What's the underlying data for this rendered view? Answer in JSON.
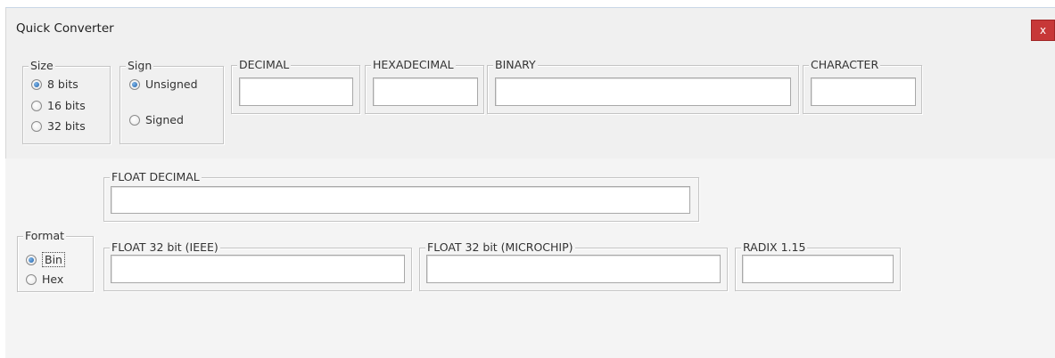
{
  "window": {
    "title": "Quick Converter",
    "close_label": "x"
  },
  "size_group": {
    "legend": "Size",
    "options": [
      {
        "label": "8 bits",
        "checked": true
      },
      {
        "label": "16 bits",
        "checked": false
      },
      {
        "label": "32 bits",
        "checked": false
      }
    ]
  },
  "sign_group": {
    "legend": "Sign",
    "options": [
      {
        "label": "Unsigned",
        "checked": true
      },
      {
        "label": "Signed",
        "checked": false
      }
    ]
  },
  "fields": {
    "decimal": {
      "label": "DECIMAL",
      "value": ""
    },
    "hexadecimal": {
      "label": "HEXADECIMAL",
      "value": ""
    },
    "binary": {
      "label": "BINARY",
      "value": ""
    },
    "character": {
      "label": "CHARACTER",
      "value": ""
    },
    "float_decimal": {
      "label": "FLOAT DECIMAL",
      "value": ""
    },
    "float_ieee": {
      "label": "FLOAT 32 bit (IEEE)",
      "value": ""
    },
    "float_microchip": {
      "label": "FLOAT 32 bit (MICROCHIP)",
      "value": ""
    },
    "radix": {
      "label": "RADIX 1.15",
      "value": ""
    }
  },
  "format_group": {
    "legend": "Format",
    "options": [
      {
        "label": "Bin",
        "checked": true
      },
      {
        "label": "Hex",
        "checked": false
      }
    ]
  }
}
